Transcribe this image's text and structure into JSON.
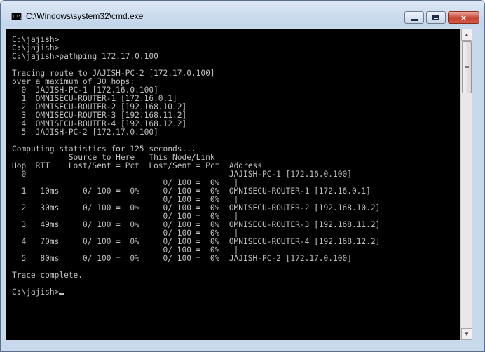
{
  "window": {
    "title": "C:\\Windows\\system32\\cmd.exe",
    "icon": "cmd-app-icon",
    "controls": {
      "minimize": "minimize-icon",
      "maximize": "maximize-icon",
      "close": "×"
    }
  },
  "console": {
    "text": "C:\\jajish>\nC:\\jajish>\nC:\\jajish>pathping 172.17.0.100\n\nTracing route to JAJISH-PC-2 [172.17.0.100]\nover a maximum of 30 hops:\n  0  JAJISH-PC-1 [172.16.0.100]\n  1  OMNISECU-ROUTER-1 [172.16.0.1]\n  2  OMNISECU-ROUTER-2 [192.168.10.2]\n  3  OMNISECU-ROUTER-3 [192.168.11.2]\n  4  OMNISECU-ROUTER-4 [192.168.12.2]\n  5  JAJISH-PC-2 [172.17.0.100]\n\nComputing statistics for 125 seconds...\n            Source to Here   This Node/Link\nHop  RTT    Lost/Sent = Pct  Lost/Sent = Pct  Address\n  0                                           JAJISH-PC-1 [172.16.0.100]\n                                0/ 100 =  0%   |\n  1   10ms     0/ 100 =  0%     0/ 100 =  0%  OMNISECU-ROUTER-1 [172.16.0.1]\n                                0/ 100 =  0%   |\n  2   30ms     0/ 100 =  0%     0/ 100 =  0%  OMNISECU-ROUTER-2 [192.168.10.2]\n                                0/ 100 =  0%   |\n  3   49ms     0/ 100 =  0%     0/ 100 =  0%  OMNISECU-ROUTER-3 [192.168.11.2]\n                                0/ 100 =  0%   |\n  4   70ms     0/ 100 =  0%     0/ 100 =  0%  OMNISECU-ROUTER-4 [192.168.12.2]\n                                0/ 100 =  0%   |\n  5   80ms     0/ 100 =  0%     0/ 100 =  0%  JAJISH-PC-2 [172.17.0.100]\n\nTrace complete.\n\nC:\\jajish>"
  },
  "scrollbar": {
    "up": "▲",
    "down": "▼"
  },
  "colors": {
    "console_bg": "#000000",
    "console_fg": "#c0c0c0",
    "close_button": "#c6422e"
  }
}
